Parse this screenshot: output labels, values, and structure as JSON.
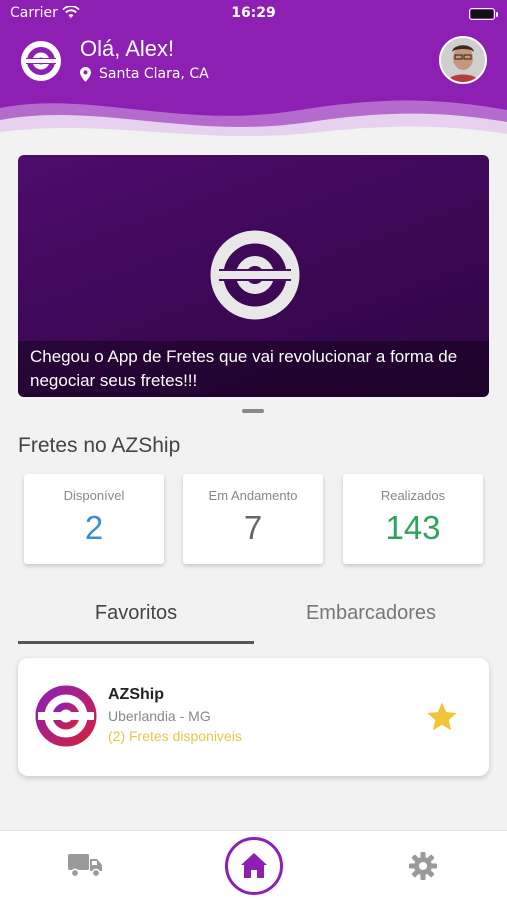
{
  "status_bar": {
    "carrier": "Carrier",
    "time": "16:29"
  },
  "header": {
    "greeting": "Olá, Alex!",
    "location": "Santa Clara, CA"
  },
  "banner": {
    "caption": "Chegou o App de Fretes que vai revolucionar a forma de negociar seus fretes!!!"
  },
  "section": {
    "title": "Fretes no AZShip"
  },
  "stats": [
    {
      "label": "Disponível",
      "value": "2",
      "color": "#3a8fd0"
    },
    {
      "label": "Em Andamento",
      "value": "7",
      "color": "#666666"
    },
    {
      "label": "Realizados",
      "value": "143",
      "color": "#2aa55a"
    }
  ],
  "tabs": [
    {
      "label": "Favoritos",
      "active": true
    },
    {
      "label": "Embarcadores",
      "active": false
    }
  ],
  "favorite": {
    "name": "AZShip",
    "city": "Uberlandia - MG",
    "fretes": "(2) Fretes disponiveis"
  },
  "colors": {
    "brand": "#8e1fb3",
    "star": "#f2c438"
  },
  "icons": {
    "truck": "truck-icon",
    "home": "home-icon",
    "settings": "gear-icon"
  }
}
